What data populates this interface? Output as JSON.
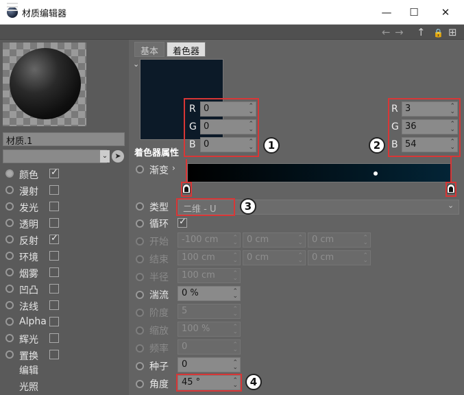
{
  "window": {
    "title": "材质编辑器",
    "minimize": "—",
    "maximize": "☐",
    "close": "✕"
  },
  "toolbar": {
    "back": "←",
    "forward": "→",
    "up": "↑",
    "lock": "🔒",
    "new": "⊞"
  },
  "material": {
    "name": "材质.1"
  },
  "channels": [
    {
      "label": "颜色",
      "radio_on": true,
      "checked": true
    },
    {
      "label": "漫射",
      "radio_on": false,
      "checked": false
    },
    {
      "label": "发光",
      "radio_on": false,
      "checked": false
    },
    {
      "label": "透明",
      "radio_on": false,
      "checked": false
    },
    {
      "label": "反射",
      "radio_on": false,
      "checked": true
    },
    {
      "label": "环境",
      "radio_on": false,
      "checked": false
    },
    {
      "label": "烟雾",
      "radio_on": false,
      "checked": false
    },
    {
      "label": "凹凸",
      "radio_on": false,
      "checked": false
    },
    {
      "label": "法线",
      "radio_on": false,
      "checked": false
    },
    {
      "label": "Alpha",
      "radio_on": false,
      "checked": false
    },
    {
      "label": "辉光",
      "radio_on": false,
      "checked": false
    },
    {
      "label": "置换",
      "radio_on": false,
      "checked": false
    }
  ],
  "extra_items": [
    "编辑",
    "光照"
  ],
  "tabs": [
    {
      "label": "基本"
    },
    {
      "label": "着色器"
    }
  ],
  "shader_title": "着色器属性",
  "rgb_left": {
    "R": "0",
    "G": "0",
    "B": "0"
  },
  "rgb_right": {
    "R": "3",
    "G": "36",
    "B": "54"
  },
  "gradient": {
    "label": "渐变",
    "start_color": "#000000",
    "end_color": "#032436"
  },
  "callouts": [
    "1",
    "2",
    "3",
    "4"
  ],
  "params": {
    "type": {
      "label": "类型",
      "value": "二维 - U"
    },
    "loop": {
      "label": "循环",
      "checked": true
    },
    "start": {
      "label": "开始",
      "values": [
        "-100 cm",
        "0 cm",
        "0 cm"
      ]
    },
    "end": {
      "label": "结束",
      "values": [
        "100 cm",
        "0 cm",
        "0 cm"
      ]
    },
    "radius": {
      "label": "半径",
      "value": "100 cm"
    },
    "turbulence": {
      "label": "湍流",
      "value": "0 %"
    },
    "octaves": {
      "label": "阶度",
      "value": "5"
    },
    "scale": {
      "label": "缩放",
      "value": "100 %"
    },
    "frequency": {
      "label": "频率",
      "value": "0"
    },
    "seed": {
      "label": "种子",
      "value": "0"
    },
    "angle": {
      "label": "角度",
      "value": "45 °"
    }
  },
  "colors": {
    "accent_red": "#d93636",
    "panel": "#636363"
  }
}
